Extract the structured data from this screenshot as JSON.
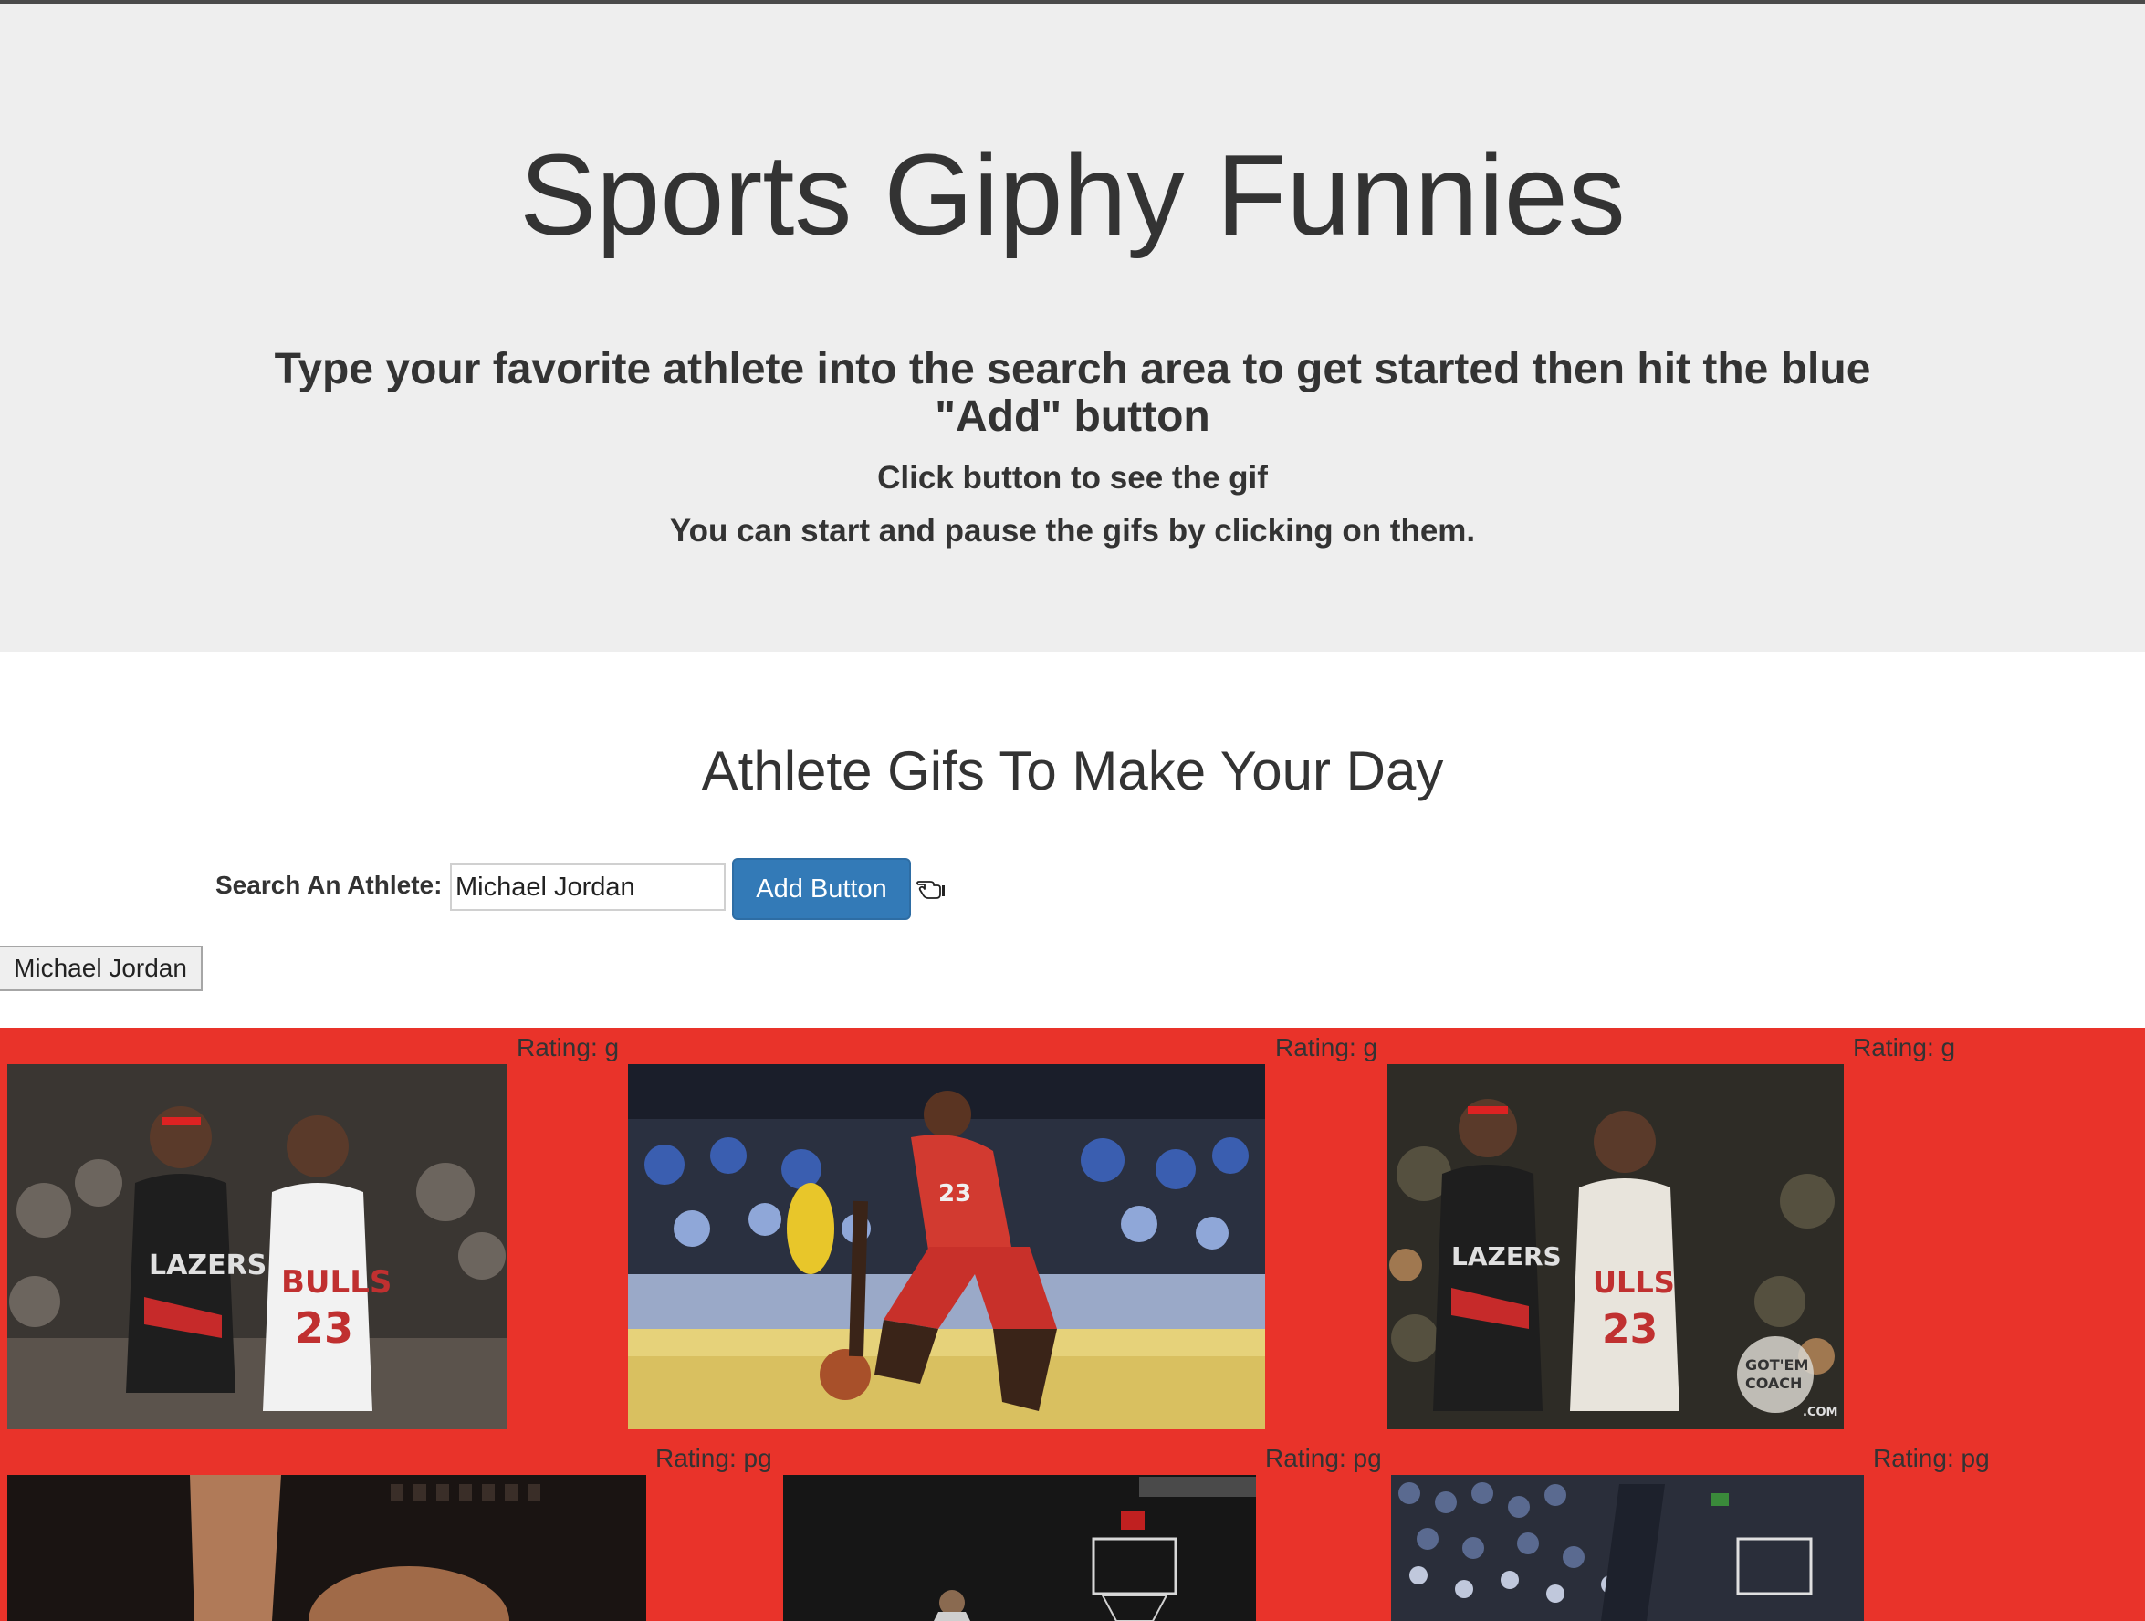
{
  "header": {
    "title": "Sports Giphy Funnies",
    "subtitle": "Type your favorite athlete into the search area to get started then hit the blue \"Add\" button",
    "line1": "Click button to see the gif",
    "line2": "You can start and pause the gifs by clicking on them."
  },
  "main": {
    "section_title": "Athlete Gifs To Make Your Day",
    "search": {
      "label": "Search An Athlete:",
      "value": "Michael Jordan",
      "button_label": "Add Button"
    },
    "athlete_buttons": [
      {
        "label": "Michael Jordan"
      }
    ]
  },
  "gifs": [
    {
      "rating": "Rating: g",
      "scene": "blazers-bulls-players"
    },
    {
      "rating": "Rating: g",
      "scene": "crossover-dribble"
    },
    {
      "rating": "Rating: g",
      "scene": "blazers-bulls-players-gotemcoach"
    },
    {
      "rating": "Rating: pg",
      "scene": "closeup-arm"
    },
    {
      "rating": "Rating: pg",
      "scene": "arena-basket"
    },
    {
      "rating": "Rating: pg",
      "scene": "crowd-basket"
    }
  ],
  "colors": {
    "jumbotron_bg": "#eeeeee",
    "gif_area_bg": "#e9332a",
    "primary_button": "#337ab7"
  },
  "icons": {
    "cursor": "hand-pointer-icon"
  }
}
